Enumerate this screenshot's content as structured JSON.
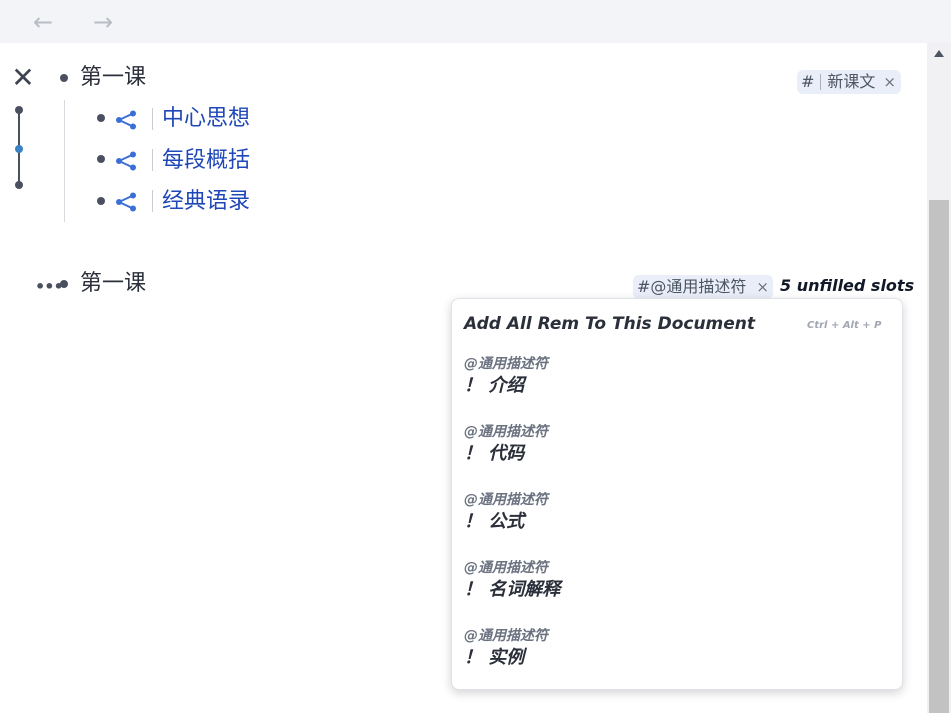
{
  "nav": {
    "back_icon": "←",
    "forward_icon": "→"
  },
  "close_icon": "✕",
  "doc1": {
    "title": "第一课",
    "tag": {
      "hash": "#",
      "label": "新课文",
      "close": "×"
    },
    "children": [
      {
        "label": "中心思想"
      },
      {
        "label": "每段概括"
      },
      {
        "label": "经典语录"
      }
    ]
  },
  "doc2": {
    "ellipsis": "•••",
    "title": "第一课",
    "tag": {
      "label": "#@通用描述符",
      "close": "×"
    },
    "unfilled_slots": "5 unfilled slots"
  },
  "popup": {
    "title": "Add All Rem To This Document",
    "shortcut": "Ctrl + Alt + P",
    "items": [
      {
        "sub": "@通用描述符",
        "main": "！ 介绍"
      },
      {
        "sub": "@通用描述符",
        "main": "！ 代码"
      },
      {
        "sub": "@通用描述符",
        "main": "！ 公式"
      },
      {
        "sub": "@通用描述符",
        "main": "！ 名词解释"
      },
      {
        "sub": "@通用描述符",
        "main": "！ 实例"
      }
    ]
  },
  "colors": {
    "accent": "#3b6fd8",
    "portal_text": "#1f47b8",
    "timeline_active": "#3b82c4",
    "topbar": "#f3f4f8"
  }
}
